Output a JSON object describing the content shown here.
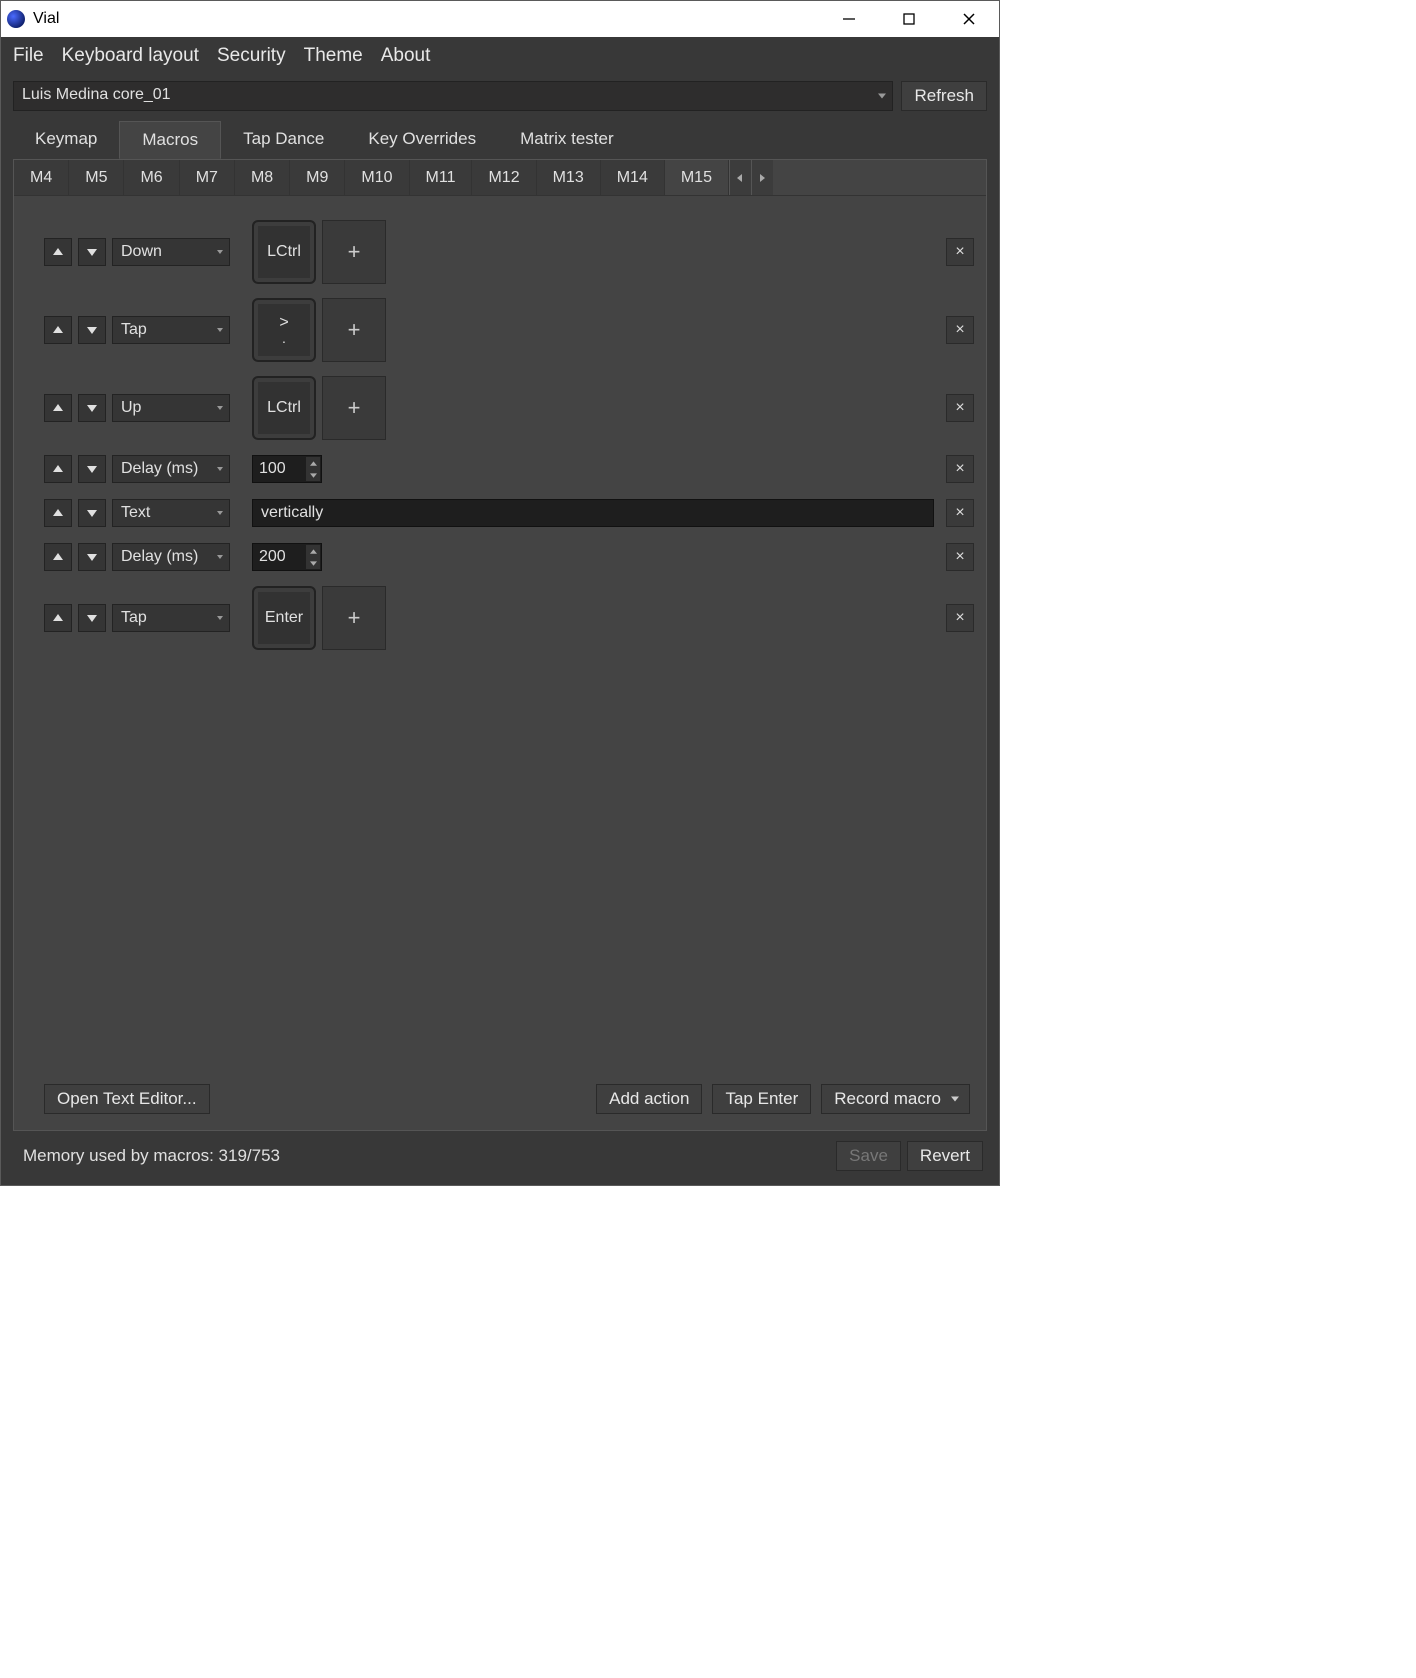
{
  "window": {
    "title": "Vial"
  },
  "menu": {
    "file": "File",
    "keyboard_layout": "Keyboard layout",
    "security": "Security",
    "theme": "Theme",
    "about": "About"
  },
  "device": {
    "name": "Luis Medina core_01",
    "refresh": "Refresh"
  },
  "tabs": {
    "keymap": "Keymap",
    "macros": "Macros",
    "tap_dance": "Tap Dance",
    "key_overrides": "Key Overrides",
    "matrix_tester": "Matrix tester",
    "active": "Macros"
  },
  "macro_tabs": [
    "M4",
    "M5",
    "M6",
    "M7",
    "M8",
    "M9",
    "M10",
    "M11",
    "M12",
    "M13",
    "M14",
    "M15"
  ],
  "macro_tab_active": "M15",
  "actions": [
    {
      "type": "Down",
      "keys": [
        "LCtrl"
      ],
      "kind": "key"
    },
    {
      "type": "Tap",
      "keys_top": ">",
      "keys_bottom": ".",
      "kind": "key2"
    },
    {
      "type": "Up",
      "keys": [
        "LCtrl"
      ],
      "kind": "key"
    },
    {
      "type": "Delay (ms)",
      "value": "100",
      "kind": "number"
    },
    {
      "type": "Text",
      "value": "vertically",
      "kind": "text"
    },
    {
      "type": "Delay (ms)",
      "value": "200",
      "kind": "number"
    },
    {
      "type": "Tap",
      "keys": [
        "Enter"
      ],
      "kind": "key"
    }
  ],
  "bottom": {
    "open_text_editor": "Open Text Editor...",
    "add_action": "Add action",
    "tap_enter": "Tap Enter",
    "record_macro": "Record macro"
  },
  "status": {
    "memory": "Memory used by macros: 319/753",
    "save": "Save",
    "revert": "Revert"
  },
  "glyphs": {
    "plus": "+",
    "close": "×"
  }
}
